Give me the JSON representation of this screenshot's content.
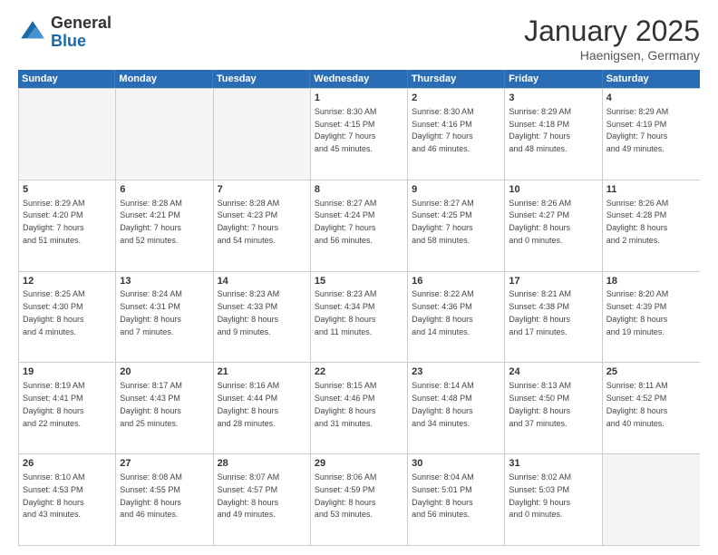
{
  "logo": {
    "general": "General",
    "blue": "Blue"
  },
  "title": "January 2025",
  "location": "Haenigsen, Germany",
  "days": [
    "Sunday",
    "Monday",
    "Tuesday",
    "Wednesday",
    "Thursday",
    "Friday",
    "Saturday"
  ],
  "rows": [
    [
      {
        "day": "",
        "info": "",
        "empty": true
      },
      {
        "day": "",
        "info": "",
        "empty": true
      },
      {
        "day": "",
        "info": "",
        "empty": true
      },
      {
        "day": "1",
        "info": "Sunrise: 8:30 AM\nSunset: 4:15 PM\nDaylight: 7 hours\nand 45 minutes.",
        "empty": false
      },
      {
        "day": "2",
        "info": "Sunrise: 8:30 AM\nSunset: 4:16 PM\nDaylight: 7 hours\nand 46 minutes.",
        "empty": false
      },
      {
        "day": "3",
        "info": "Sunrise: 8:29 AM\nSunset: 4:18 PM\nDaylight: 7 hours\nand 48 minutes.",
        "empty": false
      },
      {
        "day": "4",
        "info": "Sunrise: 8:29 AM\nSunset: 4:19 PM\nDaylight: 7 hours\nand 49 minutes.",
        "empty": false
      }
    ],
    [
      {
        "day": "5",
        "info": "Sunrise: 8:29 AM\nSunset: 4:20 PM\nDaylight: 7 hours\nand 51 minutes.",
        "empty": false
      },
      {
        "day": "6",
        "info": "Sunrise: 8:28 AM\nSunset: 4:21 PM\nDaylight: 7 hours\nand 52 minutes.",
        "empty": false
      },
      {
        "day": "7",
        "info": "Sunrise: 8:28 AM\nSunset: 4:23 PM\nDaylight: 7 hours\nand 54 minutes.",
        "empty": false
      },
      {
        "day": "8",
        "info": "Sunrise: 8:27 AM\nSunset: 4:24 PM\nDaylight: 7 hours\nand 56 minutes.",
        "empty": false
      },
      {
        "day": "9",
        "info": "Sunrise: 8:27 AM\nSunset: 4:25 PM\nDaylight: 7 hours\nand 58 minutes.",
        "empty": false
      },
      {
        "day": "10",
        "info": "Sunrise: 8:26 AM\nSunset: 4:27 PM\nDaylight: 8 hours\nand 0 minutes.",
        "empty": false
      },
      {
        "day": "11",
        "info": "Sunrise: 8:26 AM\nSunset: 4:28 PM\nDaylight: 8 hours\nand 2 minutes.",
        "empty": false
      }
    ],
    [
      {
        "day": "12",
        "info": "Sunrise: 8:25 AM\nSunset: 4:30 PM\nDaylight: 8 hours\nand 4 minutes.",
        "empty": false
      },
      {
        "day": "13",
        "info": "Sunrise: 8:24 AM\nSunset: 4:31 PM\nDaylight: 8 hours\nand 7 minutes.",
        "empty": false
      },
      {
        "day": "14",
        "info": "Sunrise: 8:23 AM\nSunset: 4:33 PM\nDaylight: 8 hours\nand 9 minutes.",
        "empty": false
      },
      {
        "day": "15",
        "info": "Sunrise: 8:23 AM\nSunset: 4:34 PM\nDaylight: 8 hours\nand 11 minutes.",
        "empty": false
      },
      {
        "day": "16",
        "info": "Sunrise: 8:22 AM\nSunset: 4:36 PM\nDaylight: 8 hours\nand 14 minutes.",
        "empty": false
      },
      {
        "day": "17",
        "info": "Sunrise: 8:21 AM\nSunset: 4:38 PM\nDaylight: 8 hours\nand 17 minutes.",
        "empty": false
      },
      {
        "day": "18",
        "info": "Sunrise: 8:20 AM\nSunset: 4:39 PM\nDaylight: 8 hours\nand 19 minutes.",
        "empty": false
      }
    ],
    [
      {
        "day": "19",
        "info": "Sunrise: 8:19 AM\nSunset: 4:41 PM\nDaylight: 8 hours\nand 22 minutes.",
        "empty": false
      },
      {
        "day": "20",
        "info": "Sunrise: 8:17 AM\nSunset: 4:43 PM\nDaylight: 8 hours\nand 25 minutes.",
        "empty": false
      },
      {
        "day": "21",
        "info": "Sunrise: 8:16 AM\nSunset: 4:44 PM\nDaylight: 8 hours\nand 28 minutes.",
        "empty": false
      },
      {
        "day": "22",
        "info": "Sunrise: 8:15 AM\nSunset: 4:46 PM\nDaylight: 8 hours\nand 31 minutes.",
        "empty": false
      },
      {
        "day": "23",
        "info": "Sunrise: 8:14 AM\nSunset: 4:48 PM\nDaylight: 8 hours\nand 34 minutes.",
        "empty": false
      },
      {
        "day": "24",
        "info": "Sunrise: 8:13 AM\nSunset: 4:50 PM\nDaylight: 8 hours\nand 37 minutes.",
        "empty": false
      },
      {
        "day": "25",
        "info": "Sunrise: 8:11 AM\nSunset: 4:52 PM\nDaylight: 8 hours\nand 40 minutes.",
        "empty": false
      }
    ],
    [
      {
        "day": "26",
        "info": "Sunrise: 8:10 AM\nSunset: 4:53 PM\nDaylight: 8 hours\nand 43 minutes.",
        "empty": false
      },
      {
        "day": "27",
        "info": "Sunrise: 8:08 AM\nSunset: 4:55 PM\nDaylight: 8 hours\nand 46 minutes.",
        "empty": false
      },
      {
        "day": "28",
        "info": "Sunrise: 8:07 AM\nSunset: 4:57 PM\nDaylight: 8 hours\nand 49 minutes.",
        "empty": false
      },
      {
        "day": "29",
        "info": "Sunrise: 8:06 AM\nSunset: 4:59 PM\nDaylight: 8 hours\nand 53 minutes.",
        "empty": false
      },
      {
        "day": "30",
        "info": "Sunrise: 8:04 AM\nSunset: 5:01 PM\nDaylight: 8 hours\nand 56 minutes.",
        "empty": false
      },
      {
        "day": "31",
        "info": "Sunrise: 8:02 AM\nSunset: 5:03 PM\nDaylight: 9 hours\nand 0 minutes.",
        "empty": false
      },
      {
        "day": "",
        "info": "",
        "empty": true
      }
    ]
  ]
}
